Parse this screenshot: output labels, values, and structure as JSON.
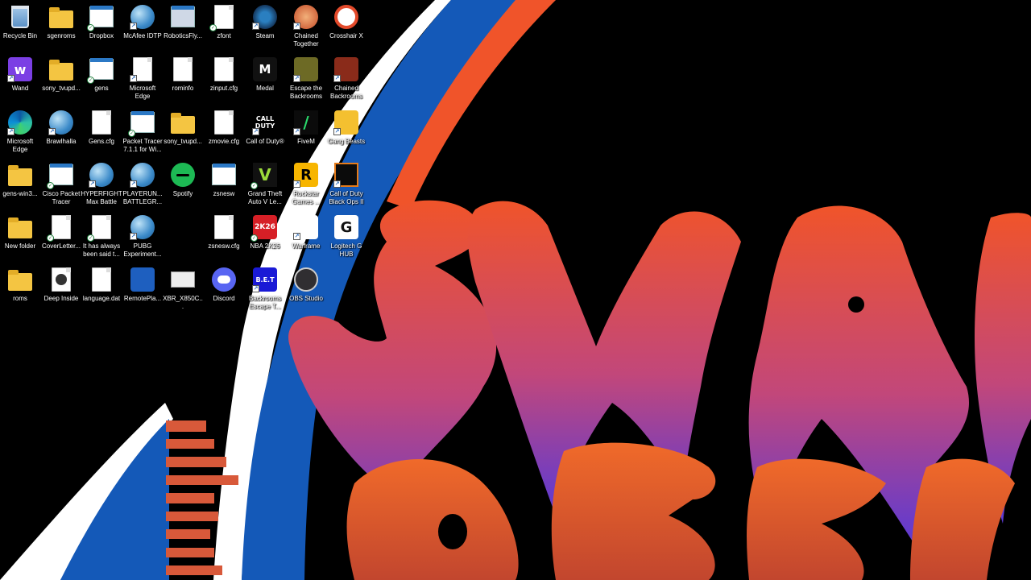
{
  "wallpaper": {
    "colors": {
      "black": "#000000",
      "blue": "#1459b8",
      "orange": "#f0542a",
      "purple": "#7a3db8",
      "white": "#ffffff"
    }
  },
  "desktop": {
    "icons": [
      {
        "id": "recycle-bin",
        "label": "Recycle Bin",
        "glyph": "bin",
        "icon": "recycle-bin-icon"
      },
      {
        "id": "wand",
        "label": "Wand",
        "glyph": "wand",
        "icon": "wand-app-icon",
        "sc": true
      },
      {
        "id": "ms-edge-1",
        "label": "Microsoft Edge",
        "glyph": "edge",
        "icon": "edge-icon",
        "sc": true
      },
      {
        "id": "gens-win3",
        "label": "gens-win3...",
        "glyph": "folder",
        "icon": "folder-icon"
      },
      {
        "id": "new-folder",
        "label": "New folder",
        "glyph": "folder",
        "icon": "folder-icon"
      },
      {
        "id": "roms",
        "label": "roms",
        "glyph": "folder",
        "icon": "folder-icon"
      },
      {
        "id": "sgenroms",
        "label": "sgenroms",
        "glyph": "folder",
        "icon": "folder-icon"
      },
      {
        "id": "sony-tvupd-1",
        "label": "sony_tvupd...",
        "glyph": "folder",
        "icon": "folder-icon"
      },
      {
        "id": "brawlhalla",
        "label": "Brawlhalla",
        "glyph": "globe",
        "icon": "globe-icon",
        "sc": true
      },
      {
        "id": "cisco-packet-tracer",
        "label": "Cisco Packet Tracer",
        "glyph": "window",
        "icon": "packet-tracer-icon",
        "badge": true
      },
      {
        "id": "coverletter",
        "label": "CoverLetter...",
        "glyph": "file",
        "icon": "document-icon",
        "badge": true
      },
      {
        "id": "deep-inside",
        "label": "Deep Inside",
        "glyph": "video",
        "icon": "video-file-icon"
      },
      {
        "id": "dropbox",
        "label": "Dropbox",
        "glyph": "window",
        "icon": "dropbox-icon",
        "badge": true
      },
      {
        "id": "gens",
        "label": "gens",
        "glyph": "window",
        "icon": "application-icon",
        "badge": true
      },
      {
        "id": "gens-cfg",
        "label": "Gens.cfg",
        "glyph": "file",
        "icon": "config-file-icon"
      },
      {
        "id": "hyperfight",
        "label": "HYPERFIGHT Max Battle",
        "glyph": "globe",
        "icon": "globe-icon",
        "sc": true
      },
      {
        "id": "it-has-always",
        "label": "It has always been said t...",
        "glyph": "file",
        "icon": "document-icon",
        "badge": true
      },
      {
        "id": "language-dat",
        "label": "language.dat",
        "glyph": "file",
        "icon": "data-file-icon"
      },
      {
        "id": "mcafee",
        "label": "McAfee IDTP",
        "glyph": "globe",
        "icon": "globe-icon",
        "sc": true
      },
      {
        "id": "ms-edge-2",
        "label": "Microsoft Edge",
        "glyph": "file",
        "icon": "document-icon",
        "sc": true
      },
      {
        "id": "packet-tracer-711",
        "label": "Packet Tracer 7.1.1 for Wi...",
        "glyph": "window",
        "icon": "packet-tracer-icon",
        "badge": true
      },
      {
        "id": "playerunknown",
        "label": "PLAYERUN... BATTLEGR...",
        "glyph": "globe",
        "icon": "globe-icon",
        "sc": true
      },
      {
        "id": "pubg-experiment",
        "label": "PUBG Experiment...",
        "glyph": "globe",
        "icon": "globe-icon",
        "sc": true
      },
      {
        "id": "remoteplay",
        "label": "RemotePla...",
        "glyph": "remoteplay",
        "icon": "remote-play-icon"
      },
      {
        "id": "roboticsfly",
        "label": "RoboticsFly...",
        "glyph": "robotics",
        "icon": "image-file-icon"
      },
      {
        "id": "rominfo",
        "label": "rominfo",
        "glyph": "file",
        "icon": "text-file-icon"
      },
      {
        "id": "sony-tvupd-2",
        "label": "sony_tvupd...",
        "glyph": "folder",
        "icon": "folder-icon"
      },
      {
        "id": "spotify",
        "label": "Spotify",
        "glyph": "spotify",
        "icon": "spotify-icon"
      },
      {
        "id": "xbr-x850c",
        "label": "XBR_X850C...",
        "glyph": "xbr",
        "icon": "image-file-icon"
      },
      {
        "id": "zfont",
        "label": "zfont",
        "glyph": "file",
        "icon": "text-file-icon",
        "badge": true
      },
      {
        "id": "zinput-cfg",
        "label": "zinput.cfg",
        "glyph": "file",
        "icon": "config-file-icon"
      },
      {
        "id": "zmovie-cfg",
        "label": "zmovie.cfg",
        "glyph": "file",
        "icon": "config-file-icon"
      },
      {
        "id": "zsnesw",
        "label": "zsnesw",
        "glyph": "window",
        "icon": "application-icon"
      },
      {
        "id": "zsnesw-cfg",
        "label": "zsnesw.cfg",
        "glyph": "file",
        "icon": "config-file-icon"
      },
      {
        "id": "discord",
        "label": "Discord",
        "glyph": "discord",
        "icon": "discord-icon"
      },
      {
        "id": "steam",
        "label": "Steam",
        "glyph": "steam",
        "icon": "steam-icon",
        "sc": true
      },
      {
        "id": "medal",
        "label": "Medal",
        "glyph": "medal",
        "icon": "medal-icon"
      },
      {
        "id": "call-of-duty",
        "label": "Call of Duty®",
        "glyph": "cod",
        "icon": "call-of-duty-icon",
        "sc": true
      },
      {
        "id": "gta-v",
        "label": "Grand Theft Auto V Le...",
        "glyph": "gtav",
        "icon": "gta-v-icon",
        "badge": true
      },
      {
        "id": "nba-2k26",
        "label": "NBA 2K26",
        "glyph": "nba",
        "icon": "nba-2k26-icon",
        "badge": true
      },
      {
        "id": "backrooms-escape",
        "label": "Backrooms Escape T...",
        "glyph": "bet",
        "icon": "backrooms-escape-icon",
        "sc": true
      },
      {
        "id": "chained-together",
        "label": "Chained Together",
        "glyph": "chained",
        "icon": "chained-together-icon",
        "sc": true
      },
      {
        "id": "escape-backrooms",
        "label": "Escape the Backrooms",
        "glyph": "escape",
        "icon": "escape-backrooms-icon",
        "sc": true
      },
      {
        "id": "fivem",
        "label": "FiveM",
        "glyph": "fivem",
        "icon": "fivem-icon",
        "sc": true
      },
      {
        "id": "rockstar",
        "label": "Rockstar Games ...",
        "glyph": "rockstar",
        "icon": "rockstar-games-icon",
        "sc": true
      },
      {
        "id": "warframe",
        "label": "Warframe",
        "glyph": "warframe",
        "icon": "warframe-icon",
        "sc": true
      },
      {
        "id": "obs-studio",
        "label": "OBS Studio",
        "glyph": "obs",
        "icon": "obs-studio-icon"
      },
      {
        "id": "crosshair-x",
        "label": "Crosshair X",
        "glyph": "crosshair",
        "icon": "crosshair-x-icon"
      },
      {
        "id": "chained-backrooms",
        "label": "Chained Backrooms",
        "glyph": "chainedb",
        "icon": "chained-backrooms-icon",
        "sc": true
      },
      {
        "id": "gang-beasts",
        "label": "Gang Beasts",
        "glyph": "gang",
        "icon": "gang-beasts-icon",
        "sc": true
      },
      {
        "id": "cod-black-ops",
        "label": "Call of Duty Black Ops II",
        "glyph": "bo2",
        "icon": "black-ops-icon",
        "sc": true
      },
      {
        "id": "logitech-g-hub",
        "label": "Logitech G HUB",
        "glyph": "ghub",
        "icon": "logitech-g-hub-icon"
      }
    ]
  }
}
